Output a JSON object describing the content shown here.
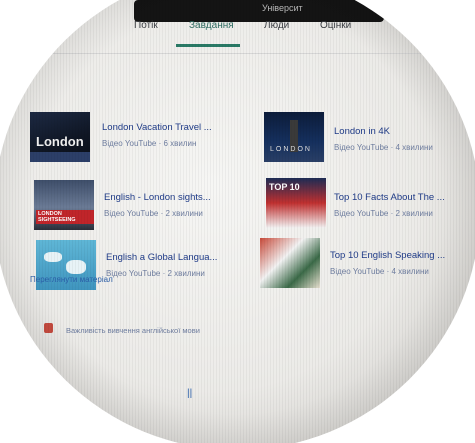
{
  "header": {
    "partial_text": "Університ"
  },
  "tabs": [
    {
      "label": "Потік",
      "active": false
    },
    {
      "label": "Завдання",
      "active": true
    },
    {
      "label": "Люди",
      "active": false
    },
    {
      "label": "Оцінки",
      "active": false
    }
  ],
  "videos": [
    {
      "title": "London Vacation Travel ...",
      "meta": "Відео YouTube · 6 хвилин",
      "thumb_text": "London"
    },
    {
      "title": "London in 4K",
      "meta": "Відео YouTube · 4 хвилини",
      "thumb_text": "LONDON"
    },
    {
      "title": "English - London sights...",
      "meta": "Відео YouTube · 2 хвилини",
      "thumb_text": "LONDON SIGHTSEEING"
    },
    {
      "title": "Top 10 Facts About The ...",
      "meta": "Відео YouTube · 2 хвилини",
      "thumb_text": "TOP 10"
    },
    {
      "title": "English a Global Langua...",
      "meta": "Відео YouTube · 2 хвилини",
      "thumb_text": ""
    },
    {
      "title": "Top 10 English Speaking ...",
      "meta": "Відео YouTube · 4 хвилини",
      "thumb_text": ""
    }
  ],
  "view_link": "Переглянути матеріал",
  "document": {
    "title": "Важливість вивчення англійської мови"
  },
  "colors": {
    "accent": "#2a7a66",
    "link": "#1f3b88",
    "meta": "#6f7ea0"
  }
}
